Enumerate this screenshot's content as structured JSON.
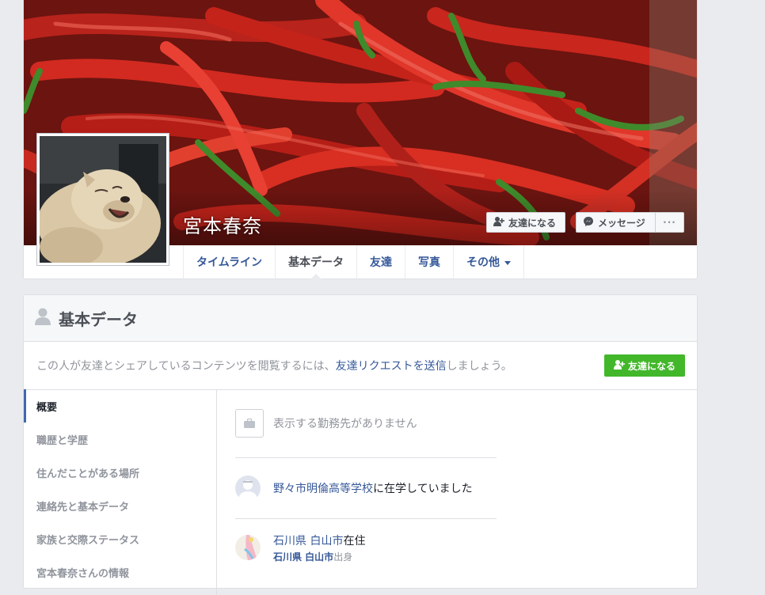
{
  "profile": {
    "name": "宮本春奈"
  },
  "cover_actions": {
    "add_friend_label": "友達になる",
    "message_label": "メッセージ",
    "more_label": "···"
  },
  "tabs": [
    {
      "label": "タイムライン",
      "active": false
    },
    {
      "label": "基本データ",
      "active": true
    },
    {
      "label": "友達",
      "active": false
    },
    {
      "label": "写真",
      "active": false
    },
    {
      "label": "その他",
      "active": false
    }
  ],
  "about": {
    "title": "基本データ",
    "notice_prefix": "この人が友達とシェアしているコンテンツを閲覧するには、",
    "notice_link": "友達リクエストを送信",
    "notice_suffix": "しましょう。",
    "add_friend_label": "友達になる"
  },
  "side_nav": [
    {
      "label": "概要",
      "active": true
    },
    {
      "label": "職歴と学歴",
      "active": false
    },
    {
      "label": "住んだことがある場所",
      "active": false
    },
    {
      "label": "連絡先と基本データ",
      "active": false
    },
    {
      "label": "家族と交際ステータス",
      "active": false
    },
    {
      "label": "宮本春奈さんの情報",
      "active": false
    }
  ],
  "overview": {
    "work_empty": "表示する勤務先がありません",
    "school_link": "野々市明倫高等学校",
    "school_suffix": "に在学していました",
    "city_link": "石川県 白山市",
    "city_suffix": "在住",
    "hometown_link": "石川県 白山市",
    "hometown_suffix": "出身"
  },
  "icons": {
    "add_friend": "add-person-icon",
    "messenger": "messenger-icon",
    "person": "person-icon",
    "briefcase": "briefcase-icon",
    "school": "school-icon",
    "location": "location-icon"
  },
  "colors": {
    "link": "#365899",
    "green_button": "#42b72a",
    "cover_red": "#c8201a"
  }
}
